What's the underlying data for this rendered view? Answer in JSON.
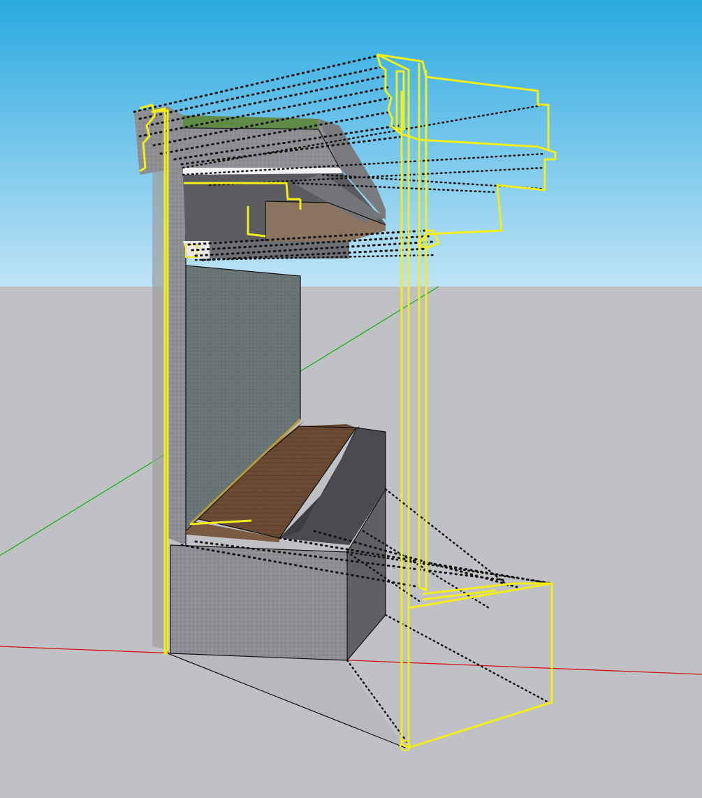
{
  "scene": {
    "sky_top": "#2aa9e0",
    "sky_bottom": "#bfe3f6",
    "ground": "#c0c1c4",
    "selection": "#f2ee1a",
    "axes": {
      "x_axis": "#d01414",
      "y_axis": "#1ab01a"
    },
    "materials": {
      "concrete": "#8d8f92",
      "concrete_dark": "#5e6063",
      "panel_wall": "#6a7576",
      "wood": "#6b4a33",
      "grass": "#5f8a48",
      "sill_dark": "#4a4b4e"
    }
  }
}
